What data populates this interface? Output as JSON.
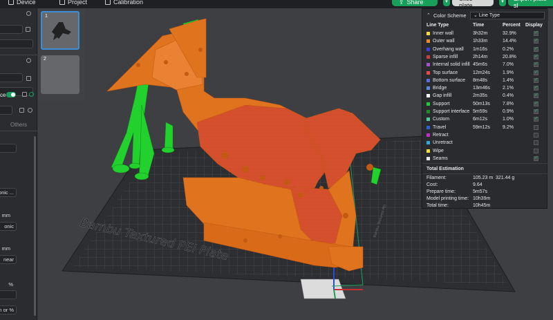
{
  "topbar": {
    "device": "Device",
    "project": "Project",
    "calibration": "Calibration",
    "share": "Share",
    "slice_plate": "Slice plate",
    "export_plate": "Export plate sl"
  },
  "sidebar": {
    "tab_others": "Others",
    "field_sonic": "onic ...",
    "field_sonic2": "onic",
    "field_linear": "near",
    "unit_mm": "mm",
    "unit_pct": "%",
    "unit_mm_or_pct": "m or %",
    "toggle_label": "ce"
  },
  "plates": [
    {
      "num": "1",
      "selected": true
    },
    {
      "num": "2",
      "selected": false
    }
  ],
  "viewport": {
    "plate_label": "Bambu Textured PEI Plate",
    "plate_side_label": "Bambu Textured PEI"
  },
  "legend": {
    "title": "Color Scheme",
    "scheme": "Line Type",
    "col_type": "Line Type",
    "col_time": "Time",
    "col_percent": "Percent",
    "col_display": "Display",
    "rows": [
      {
        "name": "Inner wall",
        "time": "3h32m",
        "pct": "32.9%",
        "color": "#f5d83a",
        "on": true
      },
      {
        "name": "Outer wall",
        "time": "1h33m",
        "pct": "14.4%",
        "color": "#f08a2a",
        "on": true
      },
      {
        "name": "Overhang wall",
        "time": "1m16s",
        "pct": "0.2%",
        "color": "#3b3fd9",
        "on": true
      },
      {
        "name": "Sparse infill",
        "time": "2h14m",
        "pct": "20.8%",
        "color": "#c94040",
        "on": true
      },
      {
        "name": "Internal solid infill",
        "time": "45m6s",
        "pct": "7.0%",
        "color": "#a450c8",
        "on": true
      },
      {
        "name": "Top surface",
        "time": "12m24s",
        "pct": "1.9%",
        "color": "#e84a4a",
        "on": true
      },
      {
        "name": "Bottom surface",
        "time": "8m48s",
        "pct": "1.4%",
        "color": "#5a6ed8",
        "on": true
      },
      {
        "name": "Bridge",
        "time": "13m46s",
        "pct": "2.1%",
        "color": "#5a8ad6",
        "on": true
      },
      {
        "name": "Gap infill",
        "time": "2m35s",
        "pct": "0.4%",
        "color": "#ffffff",
        "on": true
      },
      {
        "name": "Support",
        "time": "50m13s",
        "pct": "7.8%",
        "color": "#22c83a",
        "on": true
      },
      {
        "name": "Support interface",
        "time": "5m59s",
        "pct": "0.9%",
        "color": "#1f8a2e",
        "on": true
      },
      {
        "name": "Custom",
        "time": "6m12s",
        "pct": "1.0%",
        "color": "#52c99a",
        "on": true
      },
      {
        "name": "Travel",
        "time": "59m12s",
        "pct": "9.2%",
        "color": "#2f5fd0",
        "on": false
      },
      {
        "name": "Retract",
        "time": "",
        "pct": "",
        "color": "#c030c8",
        "on": false
      },
      {
        "name": "Unretract",
        "time": "",
        "pct": "",
        "color": "#30a8d0",
        "on": false
      },
      {
        "name": "Wipe",
        "time": "",
        "pct": "",
        "color": "#f0e030",
        "on": false
      },
      {
        "name": "Seams",
        "time": "",
        "pct": "",
        "color": "#e8e8e8",
        "on": true
      }
    ],
    "total_title": "Total Estimation",
    "filament_label": "Filament:",
    "filament_m": "105.23 m",
    "filament_g": "321.44 g",
    "cost_label": "Cost:",
    "cost": "9.64",
    "prepare_label": "Prepare time:",
    "prepare": "5m57s",
    "model_label": "Model printing time:",
    "model": "10h39m",
    "total_label": "Total time:",
    "total": "10h45m"
  }
}
